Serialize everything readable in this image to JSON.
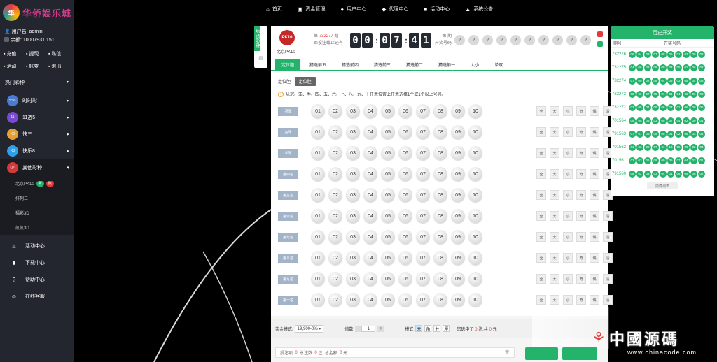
{
  "nav": {
    "items": [
      {
        "label": "首页",
        "icon": "home-icon",
        "glyph": "⌂"
      },
      {
        "label": "资金管理",
        "icon": "wallet-icon",
        "glyph": "▣"
      },
      {
        "label": "用户中心",
        "icon": "user-icon",
        "glyph": "●"
      },
      {
        "label": "代理中心",
        "icon": "diamond-icon",
        "glyph": "◆"
      },
      {
        "label": "活动中心",
        "icon": "gift-icon",
        "glyph": "■"
      },
      {
        "label": "系统公告",
        "icon": "bell-icon",
        "glyph": "▲"
      }
    ]
  },
  "sidebar": {
    "logo_text": "华侨娱乐城",
    "username_label": "用户名: admin",
    "balance_label": "余额: 10007931.151",
    "quick": [
      {
        "label": "充值",
        "icon": "recharge-icon"
      },
      {
        "label": "提现",
        "icon": "withdraw-icon"
      },
      {
        "label": "私信",
        "icon": "message-icon"
      },
      {
        "label": "活动",
        "icon": "calendar-icon"
      },
      {
        "label": "帐变",
        "icon": "chart-icon"
      },
      {
        "label": "退出",
        "icon": "power-icon"
      }
    ],
    "hot_label": "热门彩种",
    "games": [
      {
        "label": "时时彩",
        "color": "#4a7bd0",
        "tag": "SSC"
      },
      {
        "label": "11选5",
        "color": "#7a4ad0",
        "tag": "11"
      },
      {
        "label": "快三",
        "color": "#e8a030",
        "tag": "K3"
      },
      {
        "label": "快乐8",
        "color": "#30a0e8",
        "tag": "K8"
      },
      {
        "label": "其他彩种",
        "color": "#d03a3a",
        "tag": "QT"
      }
    ],
    "sub": [
      {
        "label": "北京PK10",
        "badges": [
          {
            "text": "新",
            "color": "#24b36b"
          },
          {
            "text": "热",
            "color": "#e53935"
          }
        ]
      },
      {
        "label": "排列三",
        "badges": []
      },
      {
        "label": "福彩3D",
        "badges": []
      },
      {
        "label": "凯凯3D",
        "badges": []
      }
    ],
    "bottom": [
      {
        "label": "活动中心",
        "icon": "activity-icon",
        "glyph": "♨"
      },
      {
        "label": "下载中心",
        "icon": "download-icon",
        "glyph": "⬇"
      },
      {
        "label": "帮助中心",
        "icon": "help-icon",
        "glyph": "?"
      },
      {
        "label": "在线客服",
        "icon": "service-icon",
        "glyph": "☺"
      }
    ]
  },
  "sidetab": {
    "label": "玩法彩种",
    "icon_label": "▤"
  },
  "game": {
    "logo": "PK10",
    "name": "北京PK10",
    "issue_prefix": "第",
    "issue": "732277",
    "issue_suffix": "期",
    "deadline": "距投注截止还有",
    "timer": [
      "0",
      "0",
      "0",
      "7",
      "4",
      "1"
    ],
    "draw_label1": "第 期",
    "draw_label2": "开奖号码",
    "draw_balls": [
      "?",
      "?",
      "?",
      "?",
      "?",
      "?",
      "?",
      "?",
      "?",
      "?"
    ]
  },
  "tabs": [
    "定位胆",
    "猜选前五",
    "猜选前四",
    "猜选前三",
    "猜选前二",
    "猜选前一",
    "大小",
    "单双"
  ],
  "active_tab": 0,
  "mode_label": "定位胆:",
  "mode_btn": "定位胆",
  "tip": "从冠、亚、季、四、五、六、七、八、九、十任意位置上任意选择1个或1个以上号码。",
  "positions": [
    "冠军",
    "亚军",
    "季军",
    "第四名",
    "第五名",
    "第六名",
    "第七名",
    "第八名",
    "第九名",
    "第十名"
  ],
  "numbers": [
    "01",
    "02",
    "03",
    "04",
    "05",
    "06",
    "07",
    "08",
    "09",
    "10"
  ],
  "ops": [
    "全",
    "大",
    "小",
    "奇",
    "偶",
    "清"
  ],
  "footer": {
    "prize_label": "奖金模式:",
    "prize_value": "19,900-0% ▾",
    "mult_label": "倍数",
    "mult_value": "1",
    "minus": "−",
    "plus": "+",
    "mode_label": "模式",
    "units": [
      "元",
      "角",
      "分",
      "厘"
    ],
    "sum_pre": "您选中了",
    "sum_n": "0",
    "sum_mid": "注,共",
    "sum_amt": "0",
    "sum_post": "元"
  },
  "cart": {
    "a": "投注项:",
    "av": "0",
    "b": "总注数:",
    "bv": "0",
    "bu": "注",
    "c": "总金额:",
    "cv": "0",
    "cu": "元"
  },
  "history": {
    "title": "历史开奖",
    "col_issue": "期号",
    "col_nums": "开奖号码",
    "more": "隐藏列表",
    "rows": [
      {
        "issue": "732276",
        "nums": [
          "06",
          "04",
          "03",
          "07",
          "08",
          "05",
          "01",
          "02",
          "05",
          "02"
        ]
      },
      {
        "issue": "732275",
        "nums": [
          "04",
          "06",
          "03",
          "08",
          "09",
          "07",
          "05",
          "01",
          "06",
          "02"
        ]
      },
      {
        "issue": "732274",
        "nums": [
          "07",
          "09",
          "02",
          "08",
          "04",
          "05",
          "03",
          "05",
          "04",
          "08"
        ]
      },
      {
        "issue": "732273",
        "nums": [
          "08",
          "06",
          "07",
          "05",
          "01",
          "01",
          "04",
          "02",
          "06",
          "08"
        ]
      },
      {
        "issue": "732272",
        "nums": [
          "03",
          "05",
          "04",
          "08",
          "06",
          "07",
          "01",
          "06",
          "08",
          "06"
        ]
      },
      {
        "issue": "701564",
        "nums": [
          "09",
          "05",
          "06",
          "03",
          "05",
          "07",
          "04",
          "02",
          "09",
          "01"
        ]
      },
      {
        "issue": "791563",
        "nums": [
          "07",
          "01",
          "06",
          "05",
          "05",
          "04",
          "02",
          "08",
          "03",
          "01"
        ]
      },
      {
        "issue": "701562",
        "nums": [
          "01",
          "06",
          "08",
          "07",
          "01",
          "10",
          "05",
          "09",
          "02",
          "04"
        ]
      },
      {
        "issue": "701561",
        "nums": [
          "02",
          "03",
          "06",
          "08",
          "09",
          "05",
          "07",
          "04",
          "03",
          "01"
        ]
      },
      {
        "issue": "791560",
        "nums": [
          "09",
          "02",
          "03",
          "03",
          "04",
          "01",
          "06",
          "05",
          "08",
          "02"
        ]
      }
    ]
  },
  "watermark": {
    "main": "中國源碼",
    "sub": "www.chinacode.com"
  },
  "colors": {
    "accent": "#24b36b",
    "danger": "#e53935",
    "sidebar": "#23262e"
  }
}
